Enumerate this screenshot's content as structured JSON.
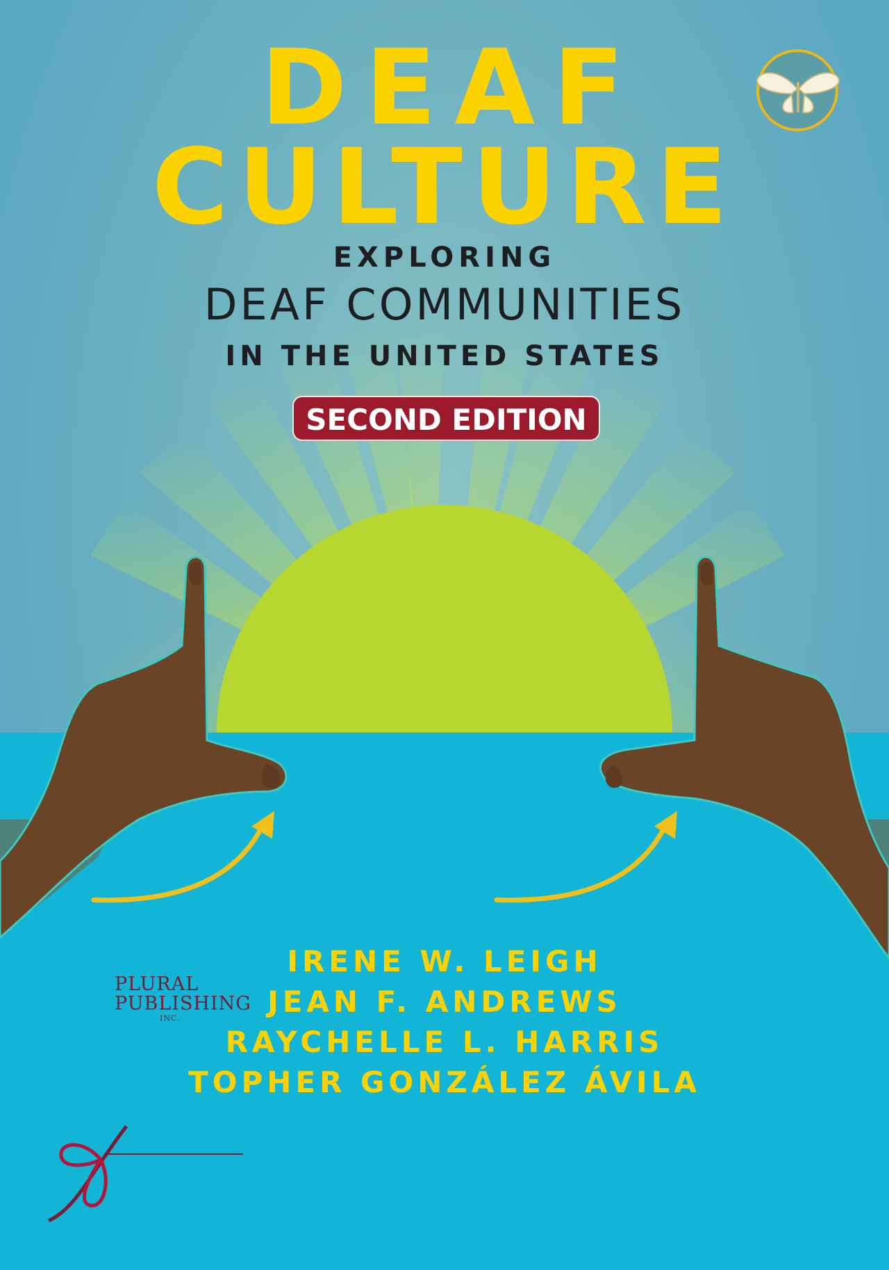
{
  "cover": {
    "title_line1": "DEAF",
    "title_line2": "CULTURE",
    "subtitle_line1": "EXPLORING",
    "subtitle_line2": "DEAF COMMUNITIES",
    "subtitle_line3": "IN THE UNITED STATES",
    "edition": "SECOND EDITION"
  },
  "authors": [
    "IRENE W. LEIGH",
    "JEAN F. ANDREWS",
    "RAYCHELLE L. HARRIS",
    "TOPHER GONZÁLEZ ÁVILA"
  ],
  "publisher": {
    "line1": "PLURAL",
    "line2": "PUBLISHING",
    "line3": "INC."
  },
  "colors": {
    "title": "#fcd200",
    "subtitle": "#1d1e22",
    "edition_badge": "#9b1b2d",
    "sky": "#6fb3c1",
    "water": "#13b5d6",
    "sun": "#b7d630",
    "hands": "#6a4426",
    "publisher": "#7b1a34"
  },
  "icons": {
    "publisher_mark": "butterfly-icon",
    "publisher_logo": "ribbon-logo-icon"
  }
}
